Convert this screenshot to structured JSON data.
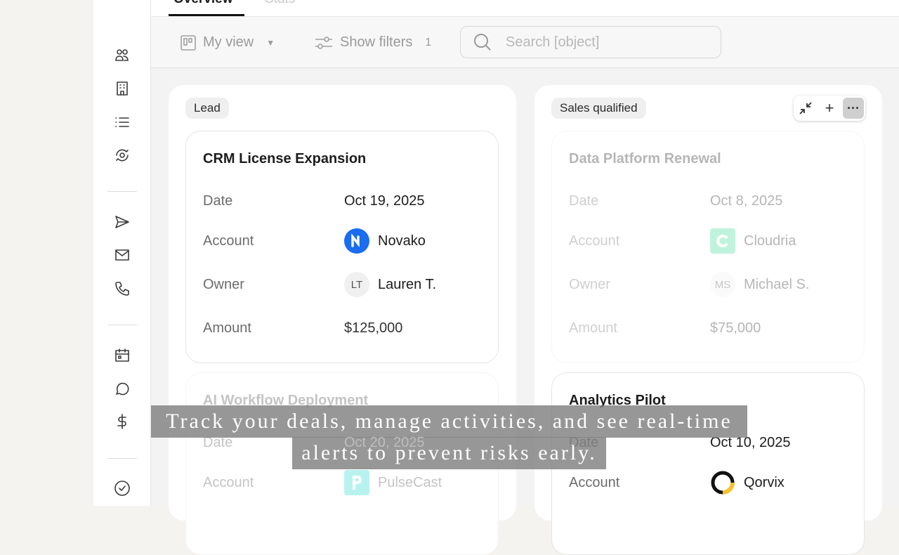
{
  "tabs": [
    {
      "label": "Overview",
      "active": true
    },
    {
      "label": "Stats",
      "active": false
    }
  ],
  "toolbar": {
    "view_label": "My view",
    "filters_label": "Show filters",
    "filters_count": "1",
    "search_placeholder": "Search [object]"
  },
  "columns": [
    {
      "stage": "Lead",
      "cards": [
        {
          "title": "CRM License Expansion",
          "date_label": "Date",
          "date": "Oct 19, 2025",
          "account_label": "Account",
          "account": "Novako",
          "owner_label": "Owner",
          "owner_initials": "LT",
          "owner": "Lauren T.",
          "amount_label": "Amount",
          "amount": "$125,000"
        },
        {
          "title": "AI Workflow Deployment",
          "date_label": "Date",
          "date": "Oct 20, 2025",
          "account_label": "Account",
          "account": "PulseCast"
        }
      ]
    },
    {
      "stage": "Sales qualified",
      "cards": [
        {
          "title": "Data Platform Renewal",
          "date_label": "Date",
          "date": "Oct 8, 2025",
          "account_label": "Account",
          "account": "Cloudria",
          "owner_label": "Owner",
          "owner_initials": "MS",
          "owner": "Michael S.",
          "amount_label": "Amount",
          "amount": "$75,000"
        },
        {
          "title": "Analytics Pilot",
          "date_label": "Date",
          "date": "Oct 10, 2025",
          "account_label": "Account",
          "account": "Qorvix"
        }
      ]
    }
  ],
  "caption": {
    "line1": "Track your deals, manage activities, and see real-time",
    "line2": "alerts to prevent risks early."
  },
  "colors": {
    "novako": "#1a6cf0",
    "cloudria": "#3ddc97",
    "pulsecast": "#4fe0d8",
    "qorvix_yellow": "#f5c12e"
  }
}
